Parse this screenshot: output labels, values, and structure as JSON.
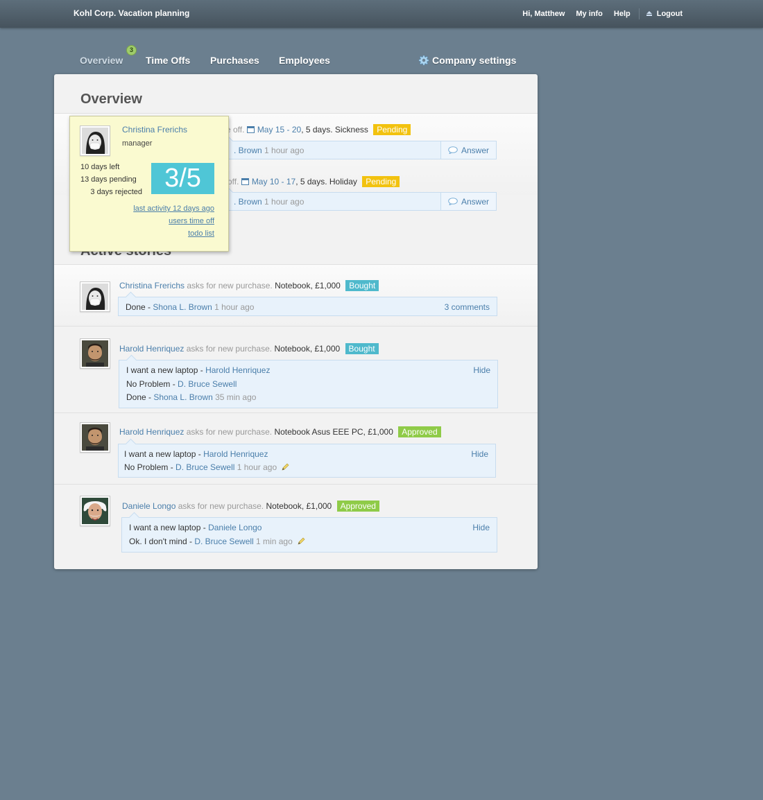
{
  "header": {
    "title": "Kohl Corp. Vacation planning",
    "greeting": "Hi, Matthew",
    "my_info": "My info",
    "help": "Help",
    "logout": "Logout"
  },
  "tabs": {
    "overview": "Overview",
    "overview_badge": "3",
    "time_offs": "Time Offs",
    "purchases": "Purchases",
    "employees": "Employees",
    "company_settings": "Company settings"
  },
  "overview": {
    "title": "Overview",
    "timeoffs": [
      {
        "prefix": "me off.",
        "dates": "May 15 - 20",
        "details": ", 5 days. Sickness",
        "status": "Pending",
        "reply_author": ". Brown",
        "reply_time": " 1 hour ago",
        "answer": "Answer"
      },
      {
        "prefix": "off.",
        "dates": "May 10 - 17",
        "details": ", 5 days. Holiday",
        "status": "Pending",
        "reply_author": ". Brown",
        "reply_time": " 1 hour ago",
        "answer": "Answer"
      }
    ]
  },
  "stories": {
    "title": "Active stories",
    "items": [
      {
        "author": "Christina Frerichs",
        "action": " asks for new purchase. ",
        "item": "Notebook, £1,000",
        "status": "Bought",
        "lines": [
          {
            "text": "Done - ",
            "who": "Shona L. Brown",
            "time": " 1 hour ago"
          }
        ],
        "right_link": "3 comments"
      },
      {
        "author": "Harold Henriquez",
        "action": " asks for new purchase. ",
        "item": "Notebook, £1,000",
        "status": "Bought",
        "lines": [
          {
            "text": "I want a new laptop - ",
            "who": "Harold Henriquez",
            "time": ""
          },
          {
            "text": "No Problem - ",
            "who": "D. Bruce Sewell",
            "time": ""
          },
          {
            "text": "Done - ",
            "who": "Shona L. Brown",
            "time": " 35 min ago"
          }
        ],
        "right_link": "Hide"
      },
      {
        "author": "Harold Henriquez",
        "action": " asks for new purchase. ",
        "item": "Notebook Asus EEE PC, £1,000",
        "status": "Approved",
        "lines": [
          {
            "text": "I want a new laptop - ",
            "who": "Harold Henriquez",
            "time": ""
          },
          {
            "text": "No Problem - ",
            "who": "D. Bruce Sewell",
            "time": " 1 hour ago"
          }
        ],
        "right_link": "Hide"
      },
      {
        "author": "Daniele Longo",
        "action": " asks for new purchase. ",
        "item": "Notebook, £1,000",
        "status": "Approved",
        "lines": [
          {
            "text": "I want a new laptop - ",
            "who": "Daniele Longo",
            "time": ""
          },
          {
            "text": "Ok. I don't mind - ",
            "who": "D. Bruce Sewell",
            "time": " 1 min ago"
          }
        ],
        "right_link": "Hide"
      }
    ]
  },
  "popup": {
    "name": "Christina Frerichs",
    "role": "manager",
    "days_left": "10 days left",
    "days_pending": "13 days pending",
    "days_rejected": "3 days rejected",
    "ratio": "3/5",
    "link_activity": "last activity 12 days ago",
    "link_timeoff": "users time off",
    "link_todo": "todo list"
  },
  "colors": {
    "background": "#6b7f8f",
    "link": "#4a7eaa",
    "pending": "#f2c20f",
    "bought": "#4fb9cc",
    "approved": "#8fcb48",
    "popup_bg": "#fafad0",
    "ratio_bg": "#4fc6d6"
  }
}
